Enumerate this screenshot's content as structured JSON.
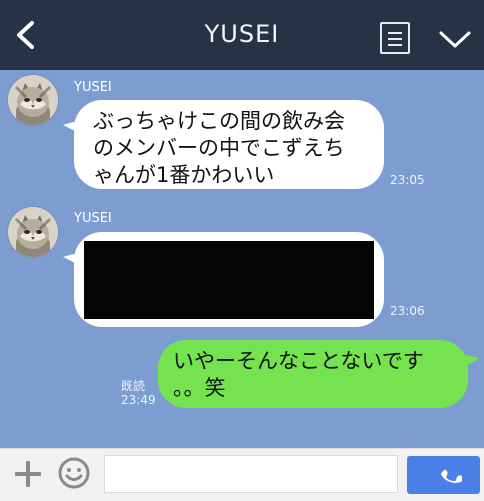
{
  "header": {
    "title": "YUSEI",
    "icons": [
      "back-chevron-icon",
      "note-list-icon",
      "chevron-down-icon"
    ]
  },
  "messages": [
    {
      "type": "received",
      "sender": "YUSEI",
      "text": "ぶっちゃけこの間の飲み会\nのメンバーの中でこずえち\nゃんが1番かわいい",
      "time": "23:05"
    },
    {
      "type": "received",
      "sender": "YUSEI",
      "content": "redacted-image",
      "time": "23:06"
    },
    {
      "type": "sent",
      "text": "いやーそんなことないです\n。。笑",
      "read_label": "既読",
      "time": "23:49"
    }
  ],
  "composer": {
    "icons": [
      "plus-icon",
      "smile-icon",
      "phone-icon"
    ],
    "input_placeholder": ""
  },
  "colors": {
    "header": "#273246",
    "background": "#7d9ccf",
    "received_bubble": "#ffffff",
    "sent_bubble": "#74e34f",
    "call_button": "#4b7ee6"
  }
}
